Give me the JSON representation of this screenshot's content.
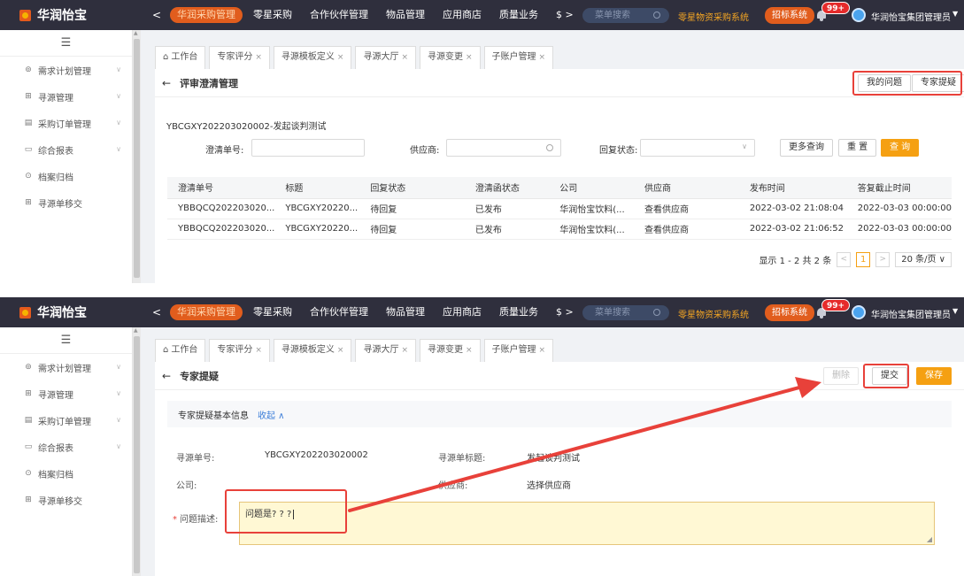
{
  "topbar": {
    "brand": "华润怡宝",
    "back": "<",
    "nav": [
      "华润采购管理",
      "零星采购",
      "合作伙伴管理",
      "物品管理",
      "应用商店",
      "质量业务",
      "$ >"
    ],
    "menu_search_placeholder": "菜单搜索",
    "link_text": "零星物资采购系统",
    "bid_button": "招标系统",
    "badge": "99+",
    "user": "华润怡宝集团管理员"
  },
  "sidebar": {
    "fold_icon": "☰",
    "items": [
      {
        "icon": "⊚",
        "label": "需求计划管理",
        "caret": true
      },
      {
        "icon": "⊞",
        "label": "寻源管理",
        "caret": true
      },
      {
        "icon": "▤",
        "label": "采购订单管理",
        "caret": true
      },
      {
        "icon": "▭",
        "label": "综合报表",
        "caret": true
      },
      {
        "icon": "⊙",
        "label": "档案归档",
        "caret": false
      },
      {
        "icon": "⊞",
        "label": "寻源单移交",
        "caret": false
      }
    ]
  },
  "tabs": [
    {
      "label": "工作台",
      "home": true,
      "close": false
    },
    {
      "label": "专家评分",
      "close": true
    },
    {
      "label": "寻源模板定义",
      "close": true
    },
    {
      "label": "寻源大厅",
      "close": true
    },
    {
      "label": "寻源变更",
      "close": true
    },
    {
      "label": "子账户管理",
      "close": true
    }
  ],
  "screen1": {
    "title": "评审澄清管理",
    "my_questions_button": "我的问题",
    "expert_question_button": "专家提疑",
    "subtitle": "YBCGXY202203020002-发起谈判测试",
    "filters": {
      "clarify_no_label": "澄清单号:",
      "supplier_label": "供应商:",
      "reply_status_label": "回复状态:",
      "more_button": "更多查询",
      "reset_button": "重 置",
      "query_button": "查 询"
    },
    "table": {
      "headers": [
        "澄清单号",
        "标题",
        "回复状态",
        "澄清函状态",
        "公司",
        "供应商",
        "发布时间",
        "答复截止时间"
      ],
      "rows": [
        [
          "YBBQCQ202203020...",
          "YBCGXY20220...",
          "待回复",
          "已发布",
          "华润怡宝饮料(...",
          "查看供应商",
          "2022-03-02 21:08:04",
          "2022-03-03 00:00:00"
        ],
        [
          "YBBQCQ202203020...",
          "YBCGXY20220...",
          "待回复",
          "已发布",
          "华润怡宝饮料(...",
          "查看供应商",
          "2022-03-02 21:06:52",
          "2022-03-03 00:00:00"
        ]
      ]
    },
    "pager": {
      "summary": "显示 1 - 2 共 2 条",
      "prev": "<",
      "page": "1",
      "next": ">",
      "page_size": "20 条/页 ∨"
    }
  },
  "screen2": {
    "title": "专家提疑",
    "delete_button": "删除",
    "submit_button": "提交",
    "save_button": "保存",
    "section_title": "专家提疑基本信息",
    "collapse_link": "收起 ∧",
    "source_no_label": "寻源单号:",
    "source_no_value": "YBCGXY202203020002",
    "source_title_label": "寻源单标题:",
    "source_title_value": "发起谈判测试",
    "company_label": "公司:",
    "supplier_label": "供应商:",
    "supplier_link": "选择供应商",
    "question_label": "问题描述:",
    "question_value": "问题是? ? ?"
  },
  "colors": {
    "topbar": "#2f2f3d",
    "accent_orange": "#f5a012",
    "nav_active": "#e15d1d",
    "annotation_red": "#e8413a",
    "link_blue": "#3b7dd8"
  }
}
